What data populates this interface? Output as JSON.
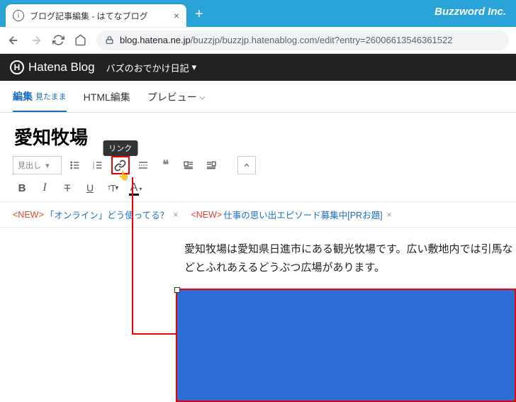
{
  "browser": {
    "tab_title": "ブログ記事編集 - はてなブログ",
    "company": "Buzzword Inc.",
    "url_host": "blog.hatena.ne.jp",
    "url_path": "/buzzjp/buzzjp.hatenablog.com/edit?entry=26006613546361522"
  },
  "hatena": {
    "brand": "Hatena Blog",
    "blog_name": "バズのおでかけ日記"
  },
  "tabs": {
    "edit": "編集",
    "edit_sub": "見たまま",
    "html": "HTML編集",
    "preview": "プレビュー"
  },
  "post": {
    "title": "愛知牧場",
    "body": "愛知牧場は愛知県日進市にある観光牧場です。広い敷地内では引馬などとふれあえるどうぶつ広場があります。"
  },
  "toolbar": {
    "heading_placeholder": "見出し",
    "link_tooltip": "リンク"
  },
  "notices": {
    "new_label": "<NEW>",
    "item1": "「オンライン」どう使ってる？",
    "item2": "仕事の思い出エピソード募集中[PRお題]"
  }
}
